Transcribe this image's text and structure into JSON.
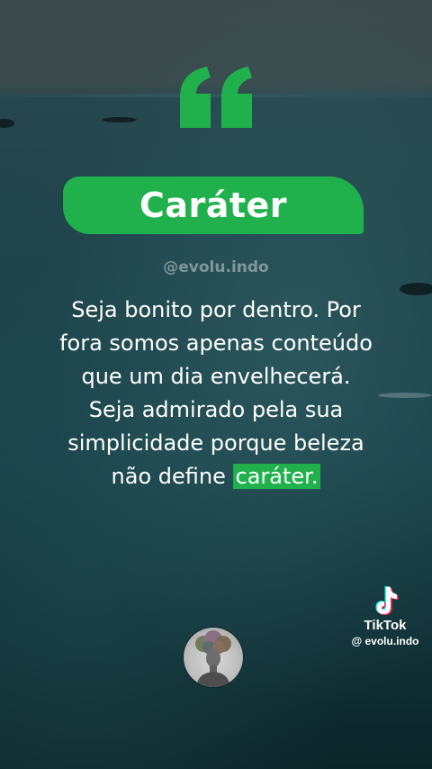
{
  "title": "Caráter",
  "handle": "@evolu.indo",
  "quote": {
    "lines": [
      "Seja bonito por dentro. Por",
      "fora somos apenas conteúdo",
      "que um dia envelhecerá.",
      "Seja admirado pela sua",
      "simplicidade porque beleza"
    ],
    "last_line_prefix": "não define ",
    "last_line_highlight": "caráter."
  },
  "tiktok": {
    "brand": "TikTok",
    "username": "@ evolu.indo"
  },
  "colors": {
    "accent": "#20b14c",
    "text": "#ffffff"
  },
  "icons": {
    "quote": "quote-mark-icon",
    "tiktok": "tiktok-logo-icon",
    "avatar": "profile-avatar"
  }
}
